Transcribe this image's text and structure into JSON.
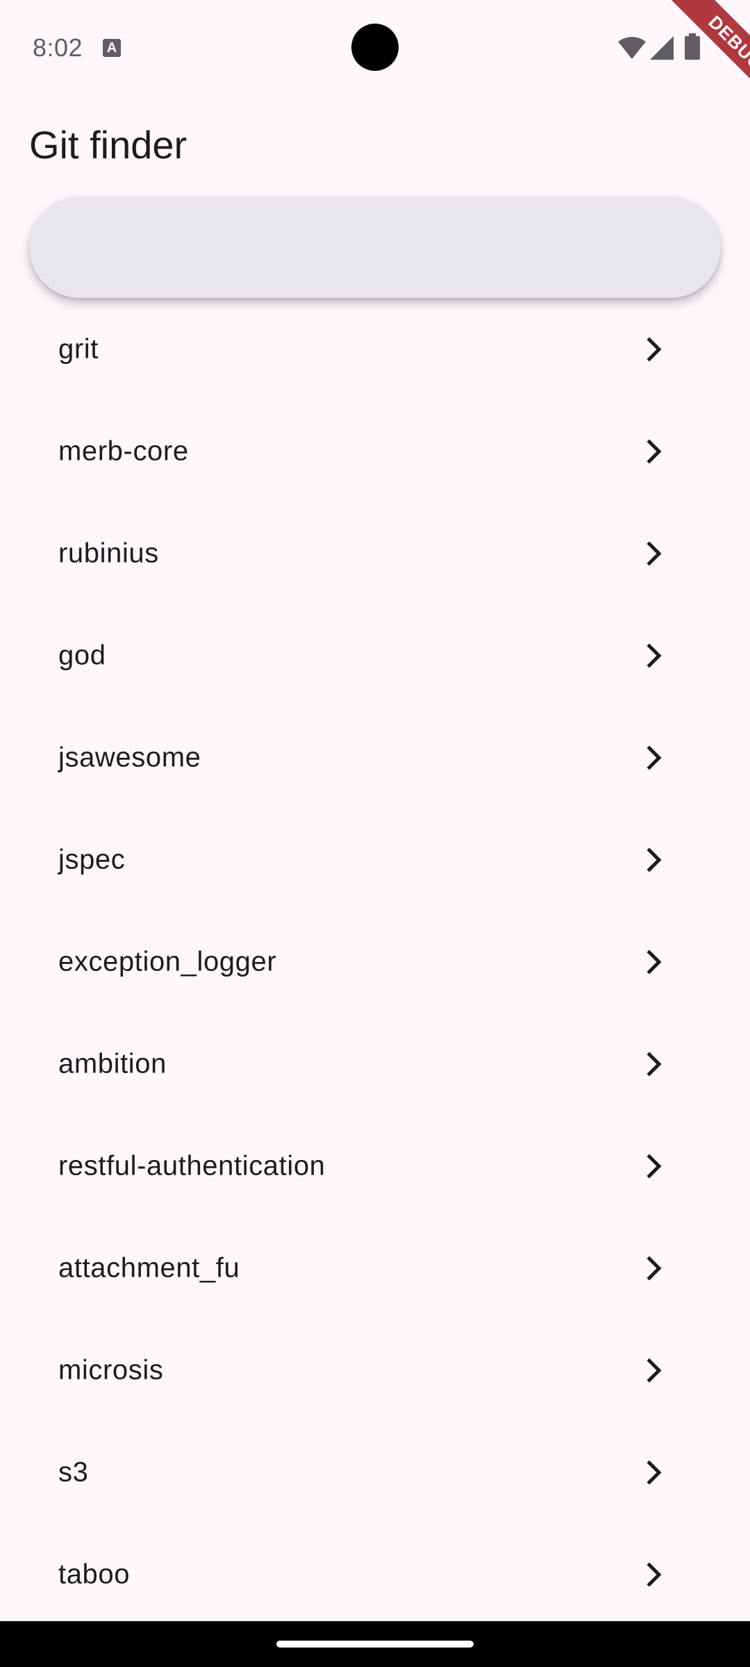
{
  "status_bar": {
    "time": "8:02",
    "indicator_letter": "A",
    "debug_label": "DEBUG"
  },
  "app_bar": {
    "title": "Git finder"
  },
  "search": {
    "value": "",
    "placeholder": ""
  },
  "repos": [
    {
      "name": "grit"
    },
    {
      "name": "merb-core"
    },
    {
      "name": "rubinius"
    },
    {
      "name": "god"
    },
    {
      "name": "jsawesome"
    },
    {
      "name": "jspec"
    },
    {
      "name": "exception_logger"
    },
    {
      "name": "ambition"
    },
    {
      "name": "restful-authentication"
    },
    {
      "name": "attachment_fu"
    },
    {
      "name": "microsis"
    },
    {
      "name": "s3"
    },
    {
      "name": "taboo"
    }
  ],
  "icons": {
    "row_trailing": "chevron-right-icon",
    "status": [
      "wifi-icon",
      "signal-icon",
      "battery-icon"
    ]
  },
  "colors": {
    "background": "#FDF7FC",
    "search_bar": "#E9E5EC",
    "debug_banner": "#B0393F",
    "text": "#1D1B20"
  }
}
